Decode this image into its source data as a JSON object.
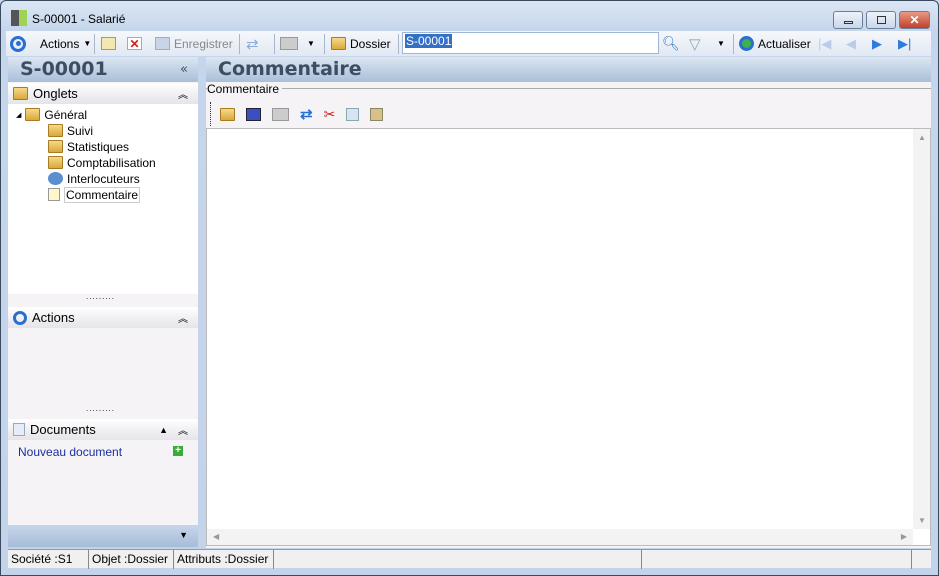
{
  "window": {
    "title": "S-00001 -  Salarié"
  },
  "toolbar": {
    "actions": "Actions",
    "save": "Enregistrer",
    "dossier": "Dossier",
    "search_value": "S-00001",
    "refresh": "Actualiser"
  },
  "left": {
    "title": "S-00001",
    "collapse": "«",
    "onglets": {
      "label": "Onglets",
      "items": [
        "Général",
        "Suivi",
        "Statistiques",
        "Comptabilisation",
        "Interlocuteurs",
        "Commentaire"
      ]
    },
    "actions": {
      "label": "Actions"
    },
    "documents": {
      "label": "Documents",
      "new": "Nouveau document"
    }
  },
  "main": {
    "title": "Commentaire",
    "group_label": "Commentaire"
  },
  "status": [
    "Société :S1",
    "Objet :Dossier",
    "Attributs :Dossier"
  ],
  "colors": {
    "accent": "#1f5fb8",
    "link": "#1a2fa0"
  }
}
